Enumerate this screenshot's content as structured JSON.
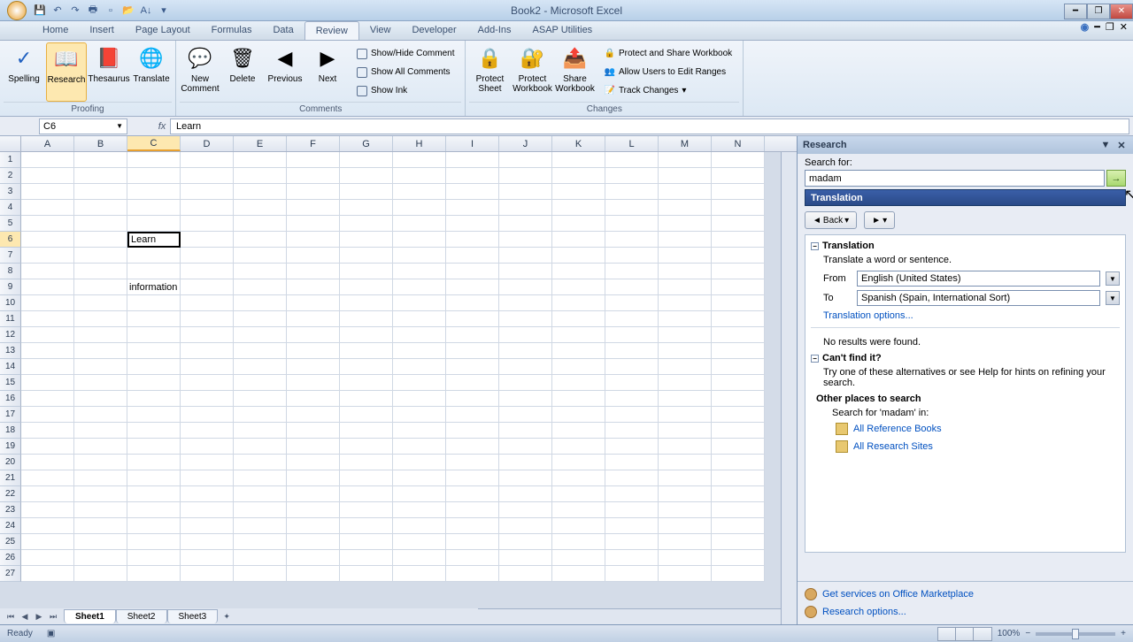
{
  "title": "Book2 - Microsoft Excel",
  "tabs": [
    "Home",
    "Insert",
    "Page Layout",
    "Formulas",
    "Data",
    "Review",
    "View",
    "Developer",
    "Add-Ins",
    "ASAP Utilities"
  ],
  "active_tab": "Review",
  "ribbon": {
    "proofing": {
      "label": "Proofing",
      "spelling": "Spelling",
      "research": "Research",
      "thesaurus": "Thesaurus",
      "translate": "Translate"
    },
    "comments": {
      "label": "Comments",
      "new": "New Comment",
      "delete": "Delete",
      "previous": "Previous",
      "next": "Next",
      "showhide": "Show/Hide Comment",
      "showall": "Show All Comments",
      "showink": "Show Ink"
    },
    "changes": {
      "label": "Changes",
      "protect_sheet": "Protect Sheet",
      "protect_wb": "Protect Workbook",
      "share": "Share Workbook",
      "protect_share": "Protect and Share Workbook",
      "allow_users": "Allow Users to Edit Ranges",
      "track": "Track Changes"
    }
  },
  "namebox": "C6",
  "formula": "Learn",
  "columns": [
    "A",
    "B",
    "C",
    "D",
    "E",
    "F",
    "G",
    "H",
    "I",
    "J",
    "K",
    "L",
    "M",
    "N"
  ],
  "rows_count": 27,
  "active_col": "C",
  "active_row": 6,
  "cells": {
    "C6": "Learn",
    "C9": "information"
  },
  "sheets": [
    "Sheet1",
    "Sheet2",
    "Sheet3"
  ],
  "active_sheet": "Sheet1",
  "research": {
    "title": "Research",
    "search_label": "Search for:",
    "search_value": "madam",
    "service": "Translation",
    "back": "Back",
    "section_translation": "Translation",
    "translate_desc": "Translate a word or sentence.",
    "from_label": "From",
    "from_value": "English (United States)",
    "to_label": "To",
    "to_value": "Spanish (Spain, International Sort)",
    "translation_options": "Translation options...",
    "no_results": "No results were found.",
    "cant_find": "Can't find it?",
    "try_alt": "Try one of these alternatives or see Help for hints on refining your search.",
    "other_places": "Other places to search",
    "search_for_in": "Search for 'madam' in:",
    "all_ref": "All Reference Books",
    "all_sites": "All Research Sites",
    "get_services": "Get services on Office Marketplace",
    "research_options": "Research options..."
  },
  "status": {
    "ready": "Ready",
    "zoom": "100%"
  }
}
